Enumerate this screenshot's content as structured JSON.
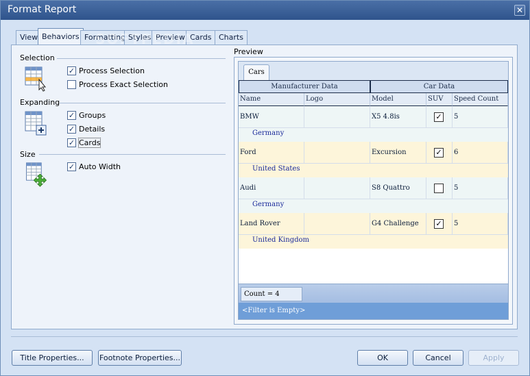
{
  "window": {
    "title": "Format Report",
    "close_glyph": "✕"
  },
  "watermark": "SOFTPEDIA",
  "tabs": [
    {
      "label": "View"
    },
    {
      "label": "Behaviors"
    },
    {
      "label": "Formatting"
    },
    {
      "label": "Styles"
    },
    {
      "label": "Preview"
    },
    {
      "label": "Cards"
    },
    {
      "label": "Charts"
    }
  ],
  "active_tab": "Behaviors",
  "selection": {
    "label": "Selection",
    "icon": "grid-selection-icon",
    "options": [
      {
        "label": "Process Selection",
        "checked": true
      },
      {
        "label": "Process Exact Selection",
        "checked": false
      }
    ]
  },
  "expanding": {
    "label": "Expanding",
    "icon": "grid-expand-icon",
    "options": [
      {
        "label": "Groups",
        "checked": true
      },
      {
        "label": "Details",
        "checked": true
      },
      {
        "label": "Cards",
        "checked": true
      }
    ]
  },
  "size": {
    "label": "Size",
    "icon": "grid-resize-icon",
    "options": [
      {
        "label": "Auto Width",
        "checked": true
      }
    ]
  },
  "preview": {
    "label": "Preview",
    "card_tab": "Cars",
    "bands": [
      "Manufacturer Data",
      "Car Data"
    ],
    "columns": [
      "Name",
      "Logo",
      "Model",
      "SUV",
      "Speed Count"
    ],
    "rows": [
      {
        "name": "BMW",
        "model": "X5 4.8is",
        "suv": true,
        "speed": "5",
        "country": "Germany"
      },
      {
        "name": "Ford",
        "model": "Excursion",
        "suv": true,
        "speed": "6",
        "country": "United States"
      },
      {
        "name": "Audi",
        "model": "S8 Quattro",
        "suv": false,
        "speed": "5",
        "country": "Germany"
      },
      {
        "name": "Land Rover",
        "model": "G4 Challenge",
        "suv": true,
        "speed": "5",
        "country": "United Kingdom"
      }
    ],
    "count": "Count = 4",
    "filter": "<Filter is Empty>"
  },
  "buttons": {
    "title_properties": "Title Properties...",
    "footnote_properties": "Footnote Properties...",
    "ok": "OK",
    "cancel": "Cancel",
    "apply": "Apply"
  },
  "check_glyph": "✓"
}
